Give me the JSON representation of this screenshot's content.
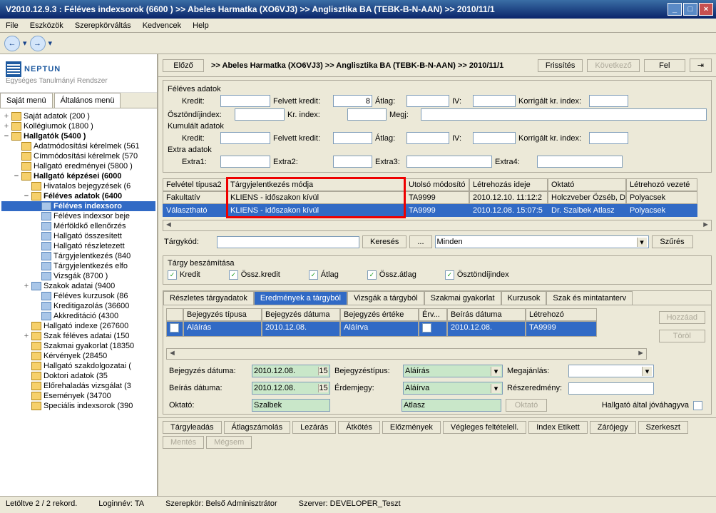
{
  "title": "V2010.12.9.3 : Féléves indexsorok (6600  )  >> Abeles Harmatka (XO6VJ3) >> Anglisztika BA (TEBK-B-N-AAN) >> 2010/11/1",
  "menu": [
    "File",
    "Eszközök",
    "Szerepkörváltás",
    "Kedvencek",
    "Help"
  ],
  "logo": {
    "brand": "NEPTUN",
    "slogan": "Egységes Tanulmányi Rendszer"
  },
  "leftTabs": [
    "Saját menü",
    "Általános menü"
  ],
  "tree": [
    {
      "d": 0,
      "t": "+",
      "i": "y",
      "txt": "Saját adatok (200  )"
    },
    {
      "d": 0,
      "t": "+",
      "i": "y",
      "txt": "Kollégiumok (1800  )"
    },
    {
      "d": 0,
      "t": "−",
      "i": "y",
      "txt": "Hallgatók (5400  )",
      "b": 1
    },
    {
      "d": 1,
      "t": "",
      "i": "y",
      "txt": "Adatmódosítási kérelmek (561"
    },
    {
      "d": 1,
      "t": "",
      "i": "y",
      "txt": "Címmódosítási kérelmek (570"
    },
    {
      "d": 1,
      "t": "",
      "i": "y",
      "txt": "Hallgató eredményei (5800  )"
    },
    {
      "d": 1,
      "t": "−",
      "i": "y",
      "txt": "Hallgató képzései (6000",
      "b": 1
    },
    {
      "d": 2,
      "t": "",
      "i": "y",
      "txt": "Hivatalos bejegyzések (6"
    },
    {
      "d": 2,
      "t": "−",
      "i": "y",
      "txt": "Féléves adatok (6400",
      "b": 1
    },
    {
      "d": 3,
      "t": "",
      "i": "b",
      "txt": "Féléves indexsoro",
      "sel": 1,
      "b": 1
    },
    {
      "d": 3,
      "t": "",
      "i": "b",
      "txt": "Féléves indexsor beje"
    },
    {
      "d": 3,
      "t": "",
      "i": "b",
      "txt": "Mérföldkő ellenőrzés"
    },
    {
      "d": 3,
      "t": "",
      "i": "b",
      "txt": "Hallgató összesített"
    },
    {
      "d": 3,
      "t": "",
      "i": "b",
      "txt": "Hallgató részletezett"
    },
    {
      "d": 3,
      "t": "",
      "i": "b",
      "txt": "Tárgyjelentkezés (840"
    },
    {
      "d": 3,
      "t": "",
      "i": "b",
      "txt": "Tárgyjelentkezés elfo"
    },
    {
      "d": 3,
      "t": "",
      "i": "b",
      "txt": "Vizsgák (8700  )"
    },
    {
      "d": 2,
      "t": "+",
      "i": "b",
      "txt": "Szakok adatai (9400"
    },
    {
      "d": 3,
      "t": "",
      "i": "b",
      "txt": "Féléves kurzusok (86"
    },
    {
      "d": 3,
      "t": "",
      "i": "b",
      "txt": "Kreditigazolás (36600"
    },
    {
      "d": 3,
      "t": "",
      "i": "b",
      "txt": "Akkreditáció (4300  "
    },
    {
      "d": 2,
      "t": "",
      "i": "y",
      "txt": "Hallgató indexe (267600"
    },
    {
      "d": 2,
      "t": "+",
      "i": "y",
      "txt": "Szak féléves adatai (150"
    },
    {
      "d": 2,
      "t": "",
      "i": "y",
      "txt": "Szakmai gyakorlat (18350"
    },
    {
      "d": 2,
      "t": "",
      "i": "y",
      "txt": "Kérvények (28450  "
    },
    {
      "d": 2,
      "t": "",
      "i": "y",
      "txt": "Hallgató szakdolgozatai ("
    },
    {
      "d": 2,
      "t": "",
      "i": "y",
      "txt": "Doktori adatok (35"
    },
    {
      "d": 2,
      "t": "",
      "i": "y",
      "txt": "Előrehaladás vizsgálat (3"
    },
    {
      "d": 2,
      "t": "",
      "i": "y",
      "txt": "Események (34700  "
    },
    {
      "d": 2,
      "t": "",
      "i": "y",
      "txt": "Speciális indexsorok (390"
    }
  ],
  "hdr": {
    "prev": "Előző",
    "crumb": ">> Abeles Harmatka (XO6VJ3) >> Anglisztika BA (TEBK-B-N-AAN) >> 2010/11/1",
    "refresh": "Frissítés",
    "next": "Következő",
    "up": "Fel"
  },
  "fields": {
    "group1": "Féléves adatok",
    "kredit": "Kredit:",
    "felvett": "Felvett kredit:",
    "felvett_v": "8",
    "atlag": "Átlag:",
    "iv": "IV:",
    "korr": "Korrigált kr. index:",
    "osztdij": "Ösztöndíjindex:",
    "kridx": "Kr. index:",
    "megj": "Megj:",
    "group2": "Kumulált adatok",
    "group3": "Extra adatok",
    "e1": "Extra1:",
    "e2": "Extra2:",
    "e3": "Extra3:",
    "e4": "Extra4:"
  },
  "grid1": {
    "cols": [
      "Felvétel típusa2",
      "Tárgyjelentkezés módja",
      "Utolsó módosító",
      "Létrehozás ideje",
      "Oktató",
      "Létrehozó vezeté"
    ],
    "rows": [
      [
        "Fakultatív",
        "KLIENS - időszakon kívül",
        "TA9999",
        "2010.12.10. 11:12:2",
        "Holczveber Özséb, D",
        "Polyacsek"
      ],
      [
        "Választható",
        "KLIENS - időszakon kívül",
        "TA9999",
        "2010.12.08. 15:07:5",
        "Dr. Szalbek Atlasz",
        "Polyacsek"
      ]
    ]
  },
  "search": {
    "targykod": "Tárgykód:",
    "kereses": "Keresés",
    "minden": "Minden",
    "szures": "Szűrés"
  },
  "beszamitas": {
    "title": "Tárgy beszámítása",
    "items": [
      "Kredit",
      "Össz.kredit",
      "Átlag",
      "Össz.átlag",
      "Ösztöndíjindex"
    ]
  },
  "tabs2": [
    "Részletes tárgyadatok",
    "Eredmények a tárgyból",
    "Vizsgák a tárgyból",
    "Szakmai gyakorlat",
    "Kurzusok",
    "Szak és mintatanterv"
  ],
  "grid2": {
    "cols": [
      "",
      "Bejegyzés típusa",
      "Bejegyzés dátuma",
      "Bejegyzés értéke",
      "Érv...",
      "Beírás dátuma",
      "Létrehozó"
    ],
    "row": [
      "",
      "Aláírás",
      "2010.12.08.",
      "Aláírva",
      "",
      "2010.12.08.",
      "TA9999"
    ],
    "hozzaad": "Hozzáad",
    "torol": "Töröl"
  },
  "form": {
    "bejdat": "Bejegyzés dátuma:",
    "bejdat_v": "2010.12.08.",
    "bejtip": "Bejegyzéstípus:",
    "bejtip_v": "Aláírás",
    "megaj": "Megajánlás:",
    "beirdat": "Beírás dátuma:",
    "beirdat_v": "2010.12.08.",
    "erdem": "Érdemjegy:",
    "erdem_v": "Aláírva",
    "reszer": "Részeredmény:",
    "oktato": "Oktató:",
    "okt_last": "Szalbek",
    "okt_first": "Atlasz",
    "okt_btn": "Oktató",
    "jovahagy": "Hallgató által jóváhagyva"
  },
  "btnbar": [
    "Tárgyleadás",
    "Átlagszámolás",
    "Lezárás",
    "Átkötés",
    "Előzmények",
    "Végleges feltételell.",
    "Index Etikett",
    "Zárójegy",
    "Szerkeszt",
    "Mentés",
    "Mégsem"
  ],
  "status": {
    "rec": "Letöltve 2 / 2 rekord.",
    "login": "Loginnév: TA",
    "role": "Szerepkör: Belső Adminisztrátor",
    "srv": "Szerver: DEVELOPER_Teszt"
  }
}
